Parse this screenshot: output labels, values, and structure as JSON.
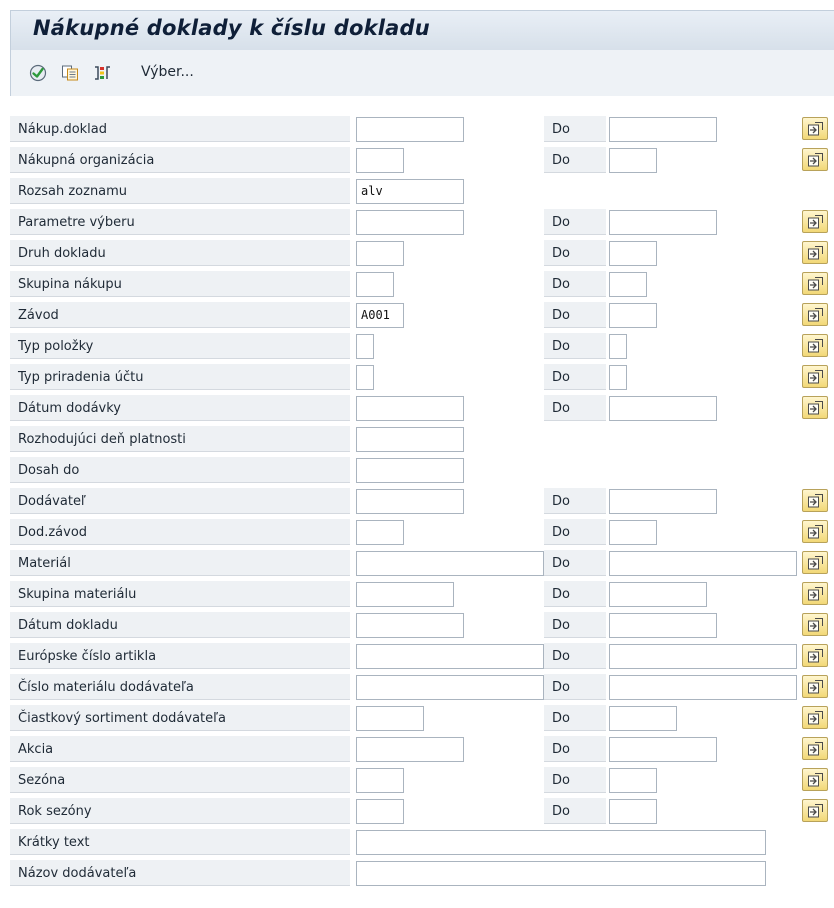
{
  "title": "Nákupné doklady k číslu dokladu",
  "toolbar": {
    "icons": [
      "execute-icon",
      "get-variant-icon",
      "selection-options-icon"
    ],
    "selection_label": "Výber..."
  },
  "to_label": "Do",
  "fields": [
    {
      "label": "Nákup.doklad",
      "value": "",
      "to_value": ""
    },
    {
      "label": "Nákupná organizácia",
      "value": "",
      "to_value": ""
    },
    {
      "label": "Rozsah zoznamu",
      "value": "alv"
    },
    {
      "label": "Parametre výberu",
      "value": "",
      "to_value": ""
    },
    {
      "label": "Druh dokladu",
      "value": "",
      "to_value": ""
    },
    {
      "label": "Skupina nákupu",
      "value": "",
      "to_value": ""
    },
    {
      "label": "Závod",
      "value": "A001",
      "to_value": ""
    },
    {
      "label": "Typ položky",
      "value": "",
      "to_value": ""
    },
    {
      "label": "Typ priradenia účtu",
      "value": "",
      "to_value": ""
    },
    {
      "label": "Dátum dodávky",
      "value": "",
      "to_value": ""
    },
    {
      "label": "Rozhodujúci deň platnosti",
      "value": ""
    },
    {
      "label": "Dosah do",
      "value": ""
    },
    {
      "label": "Dodávateľ",
      "value": "",
      "to_value": ""
    },
    {
      "label": "Dod.závod",
      "value": "",
      "to_value": ""
    },
    {
      "label": "Materiál",
      "value": "",
      "to_value": ""
    },
    {
      "label": "Skupina materiálu",
      "value": "",
      "to_value": ""
    },
    {
      "label": "Dátum dokladu",
      "value": "",
      "to_value": ""
    },
    {
      "label": "Európske číslo artikla",
      "value": "",
      "to_value": ""
    },
    {
      "label": "Číslo materiálu dodávateľa",
      "value": "",
      "to_value": ""
    },
    {
      "label": "Čiastkový sortiment dodávateľa",
      "value": "",
      "to_value": ""
    },
    {
      "label": "Akcia",
      "value": "",
      "to_value": ""
    },
    {
      "label": "Sezóna",
      "value": "",
      "to_value": ""
    },
    {
      "label": "Rok sezóny",
      "value": "",
      "to_value": ""
    },
    {
      "label": "Krátky text",
      "value": ""
    },
    {
      "label": "Názov dodávateľa",
      "value": ""
    }
  ],
  "multi_select_icon": "multiple-selection-arrow-icon",
  "colors": {
    "title_bar": "#dfe6ee",
    "label_bg": "#eef1f4",
    "multi_button": "#f2d877"
  }
}
